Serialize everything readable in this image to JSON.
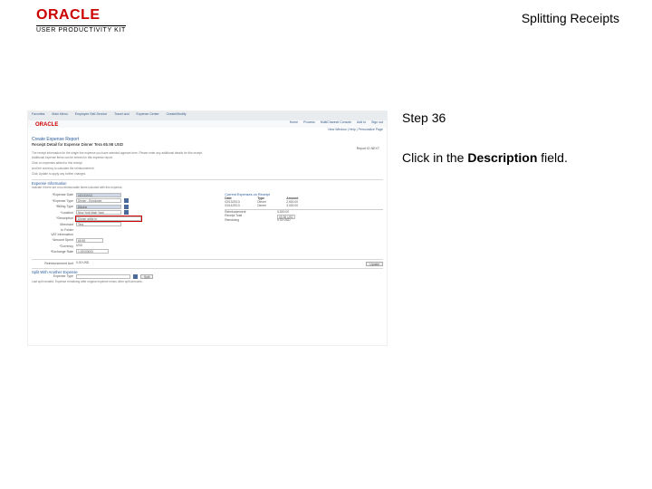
{
  "header": {
    "brand": "ORACLE",
    "subbrand": "USER PRODUCTIVITY KIT",
    "doc_title": "Splitting Receipts"
  },
  "instruction": {
    "step_label": "Step 36",
    "text_prefix": "Click in the ",
    "text_bold": "Description",
    "text_suffix": " field."
  },
  "app": {
    "nav": [
      "Favorites",
      "Main Menu",
      "Employee Self-Service",
      "Travel and",
      "Expense Center",
      "Create/Modify"
    ],
    "subnav": [
      "Home",
      "Process",
      "MultiChannel Console",
      "Add to",
      "Sign out"
    ],
    "crumb": "New Window | Help | Personalize Page",
    "brand": "ORACLE",
    "h1": "Create Expense Report",
    "h2": "Receipt Detail for Expense Dinner  Tera 65.98 USD",
    "meta": "Report ID  NEXT",
    "paragraphs": [
      "The receipt information for the single line expense you have selected appears here. Please enter any additional details for this receipt.",
      "Additional expense items can be entered in this expense report.",
      "Click on expenses added to this receipt.",
      "And the currency to calculate the reimbursement.",
      "Click Update to apply any further changes."
    ],
    "section1": "Expense Information",
    "section1_hint": "Indicate if there are non-reimbursable items included with this expense.",
    "fields": {
      "expense_date": {
        "label": "*Expense Date",
        "value": "03/13/2013"
      },
      "expense_type": {
        "label": "*Expense Type",
        "value": "Dinner - Employee"
      },
      "billing_type": {
        "label": "*Billing Type",
        "value": "Billable"
      },
      "location": {
        "label": "*Location",
        "value": "New York Main Yard"
      },
      "description": {
        "label": "*Description",
        "value": "Dinner while in"
      },
      "merchant": {
        "label": "Merchant",
        "value": "Tera"
      },
      "in_folder": {
        "label": "In Folder",
        "value": ""
      },
      "vat_info": {
        "label": "VAT Information",
        "value": ""
      },
      "amount_spent": {
        "label": "*Amount Spent",
        "value": "65.98"
      },
      "currency": {
        "label": "*Currency",
        "value": "USD"
      },
      "exchange_rate": {
        "label": "*Exchange Rate",
        "value": "1.00000000"
      },
      "reimburse_amt": {
        "label": "Reimbursement Amt",
        "value": "0.00   USD"
      }
    },
    "rt_title": "Current Expenses on Receipt",
    "rt_cols": [
      "Date",
      "Type",
      "Amount"
    ],
    "rt_rows": [
      [
        "03/13/2013",
        "Dinner",
        "2,500.00"
      ],
      [
        "03/14/2013",
        "Dinner",
        "3,000.00"
      ]
    ],
    "rt_totals": [
      {
        "label": "Reimbursement",
        "value": "5,500.00"
      },
      {
        "label": "Receipt Total",
        "value": "65.98  USD"
      },
      {
        "label": "Remaining",
        "value": "0.00  USD"
      }
    ],
    "update_btn": "Update",
    "split_label": "Split With Another Expense",
    "split_type_label": "Expense Type",
    "split_btn": "Split",
    "footer_note": "Last split created. Expense remaining after original expense minus other split amounts."
  }
}
